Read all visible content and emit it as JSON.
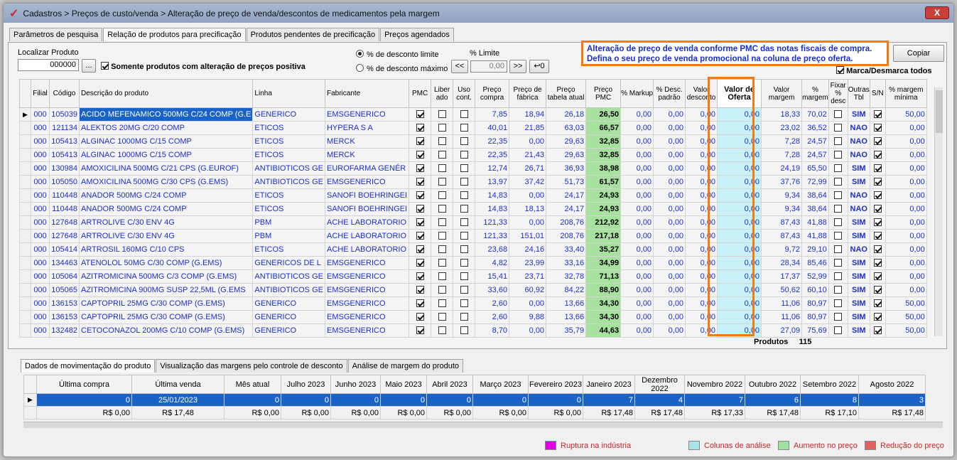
{
  "window": {
    "title": "Cadastros > Preços de custo/venda > Alteração de preço de venda/descontos de medicamentos pela margem",
    "close": "X"
  },
  "tabs": [
    "Parâmetros de pesquisa",
    "Relação de produtos para precificação",
    "Produtos pendentes de precificação",
    "Preços agendados"
  ],
  "filters": {
    "localizar_label": "Localizar Produto",
    "localizar_value": "000000",
    "ellipsis": "...",
    "somente_label": "Somente produtos com alteração de preços positiva",
    "radio1": "% de desconto limite",
    "radio2": "% de desconto máximo",
    "limite_label": "% Limite",
    "limite_value": "0,00",
    "prev": "<<",
    "next": ">>",
    "undo": "↩0",
    "copiar": "Copiar",
    "marca": "Marca/Desmarca todos"
  },
  "callout": {
    "line1": "Alteração de preço de venda conforme PMC das notas fiscais de compra.",
    "line2": "Defina o seu preço de venda promocional na coluna de preço oferta."
  },
  "grid": {
    "headers": [
      "Filial",
      "Código",
      "Descrição do produto",
      "Linha",
      "Fabricante",
      "PMC",
      "Liber ado",
      "Uso cont.",
      "Preço compra",
      "Preço de fábrica",
      "Preço tabela atual",
      "Preço PMC",
      "% Markup",
      "% Desc. padrão",
      "Valor desconto",
      "Valor de Oferta",
      "Valor margem",
      "% margem",
      "Fixar % desc",
      "Outras Tbl",
      "S/N",
      "% margem mínima"
    ],
    "rows": [
      [
        "000",
        "105039",
        "ACIDO MEFENAMICO 500MG C/24 COMP (G.E",
        "GENERICO",
        "EMSGENERICO",
        "7,85",
        "18,94",
        "26,18",
        "26,50",
        "0,00",
        "0,00",
        "0,00",
        "0,00",
        "18,33",
        "70,02",
        "SIM",
        "50,00"
      ],
      [
        "000",
        "121134",
        "ALEKTOS 20MG C/20 COMP",
        "ETICOS",
        "HYPERA S A",
        "40,01",
        "21,85",
        "63,03",
        "66,57",
        "0,00",
        "0,00",
        "0,00",
        "0,00",
        "23,02",
        "36,52",
        "NAO",
        "0,00"
      ],
      [
        "000",
        "105413",
        "ALGINAC 1000MG C/15 COMP",
        "ETICOS",
        "MERCK",
        "22,35",
        "0,00",
        "29,63",
        "32,85",
        "0,00",
        "0,00",
        "0,00",
        "0,00",
        "7,28",
        "24,57",
        "NAO",
        "0,00"
      ],
      [
        "000",
        "105413",
        "ALGINAC 1000MG C/15 COMP",
        "ETICOS",
        "MERCK",
        "22,35",
        "21,43",
        "29,63",
        "32,85",
        "0,00",
        "0,00",
        "0,00",
        "0,00",
        "7,28",
        "24,57",
        "NAO",
        "0,00"
      ],
      [
        "000",
        "130984",
        "AMOXICILINA 500MG C/21 CPS (G.EUROF)",
        "ANTIBIOTICOS GE",
        "EUROFARMA GENÉR",
        "12,74",
        "26,71",
        "36,93",
        "38,98",
        "0,00",
        "0,00",
        "0,00",
        "0,00",
        "24,19",
        "65,50",
        "SIM",
        "0,00"
      ],
      [
        "000",
        "105050",
        "AMOXICILINA 500MG C/30 CPS (G.EMS)",
        "ANTIBIOTICOS GE",
        "EMSGENERICO",
        "13,97",
        "37,42",
        "51,73",
        "61,57",
        "0,00",
        "0,00",
        "0,00",
        "0,00",
        "37,76",
        "72,99",
        "SIM",
        "0,00"
      ],
      [
        "000",
        "110448",
        "ANADOR 500MG C/24 COMP",
        "ETICOS",
        "SANOFI BOEHRINGEI",
        "14,83",
        "0,00",
        "24,17",
        "24,93",
        "0,00",
        "0,00",
        "0,00",
        "0,00",
        "9,34",
        "38,64",
        "NAO",
        "0,00"
      ],
      [
        "000",
        "110448",
        "ANADOR 500MG C/24 COMP",
        "ETICOS",
        "SANOFI BOEHRINGEI",
        "14,83",
        "18,13",
        "24,17",
        "24,93",
        "0,00",
        "0,00",
        "0,00",
        "0,00",
        "9,34",
        "38,64",
        "NAO",
        "0,00"
      ],
      [
        "000",
        "127648",
        "ARTROLIVE C/30 ENV 4G",
        "PBM",
        "ACHE LABORATORIO",
        "121,33",
        "0,00",
        "208,76",
        "212,92",
        "0,00",
        "0,00",
        "0,00",
        "0,00",
        "87,43",
        "41,88",
        "SIM",
        "0,00"
      ],
      [
        "000",
        "127648",
        "ARTROLIVE C/30 ENV 4G",
        "PBM",
        "ACHE LABORATORIO",
        "121,33",
        "151,01",
        "208,76",
        "217,18",
        "0,00",
        "0,00",
        "0,00",
        "0,00",
        "87,43",
        "41,88",
        "SIM",
        "0,00"
      ],
      [
        "000",
        "105414",
        "ARTROSIL 160MG C/10 CPS",
        "ETICOS",
        "ACHE LABORATORIO",
        "23,68",
        "24,16",
        "33,40",
        "35,27",
        "0,00",
        "0,00",
        "0,00",
        "0,00",
        "9,72",
        "29,10",
        "NAO",
        "0,00"
      ],
      [
        "000",
        "134463",
        "ATENOLOL 50MG C/30 COMP (G.EMS)",
        "GENERICOS DE L",
        "EMSGENERICO",
        "4,82",
        "23,99",
        "33,16",
        "34,99",
        "0,00",
        "0,00",
        "0,00",
        "0,00",
        "28,34",
        "85,46",
        "SIM",
        "0,00"
      ],
      [
        "000",
        "105064",
        "AZITROMICINA 500MG C/3 COMP (G.EMS)",
        "ANTIBIOTICOS GE",
        "EMSGENERICO",
        "15,41",
        "23,71",
        "32,78",
        "71,13",
        "0,00",
        "0,00",
        "0,00",
        "0,00",
        "17,37",
        "52,99",
        "SIM",
        "0,00"
      ],
      [
        "000",
        "105065",
        "AZITROMICINA 900MG SUSP 22,5ML (G.EMS",
        "ANTIBIOTICOS GE",
        "EMSGENERICO",
        "33,60",
        "60,92",
        "84,22",
        "88,90",
        "0,00",
        "0,00",
        "0,00",
        "0,00",
        "50,62",
        "60,10",
        "SIM",
        "0,00"
      ],
      [
        "000",
        "136153",
        "CAPTOPRIL 25MG C/30 COMP (G.EMS)",
        "GENERICO",
        "EMSGENERICO",
        "2,60",
        "0,00",
        "13,66",
        "34,30",
        "0,00",
        "0,00",
        "0,00",
        "0,00",
        "11,06",
        "80,97",
        "SIM",
        "50,00"
      ],
      [
        "000",
        "136153",
        "CAPTOPRIL 25MG C/30 COMP (G.EMS)",
        "GENERICO",
        "EMSGENERICO",
        "2,60",
        "9,88",
        "13,66",
        "34,30",
        "0,00",
        "0,00",
        "0,00",
        "0,00",
        "11,06",
        "80,97",
        "SIM",
        "50,00"
      ],
      [
        "000",
        "132482",
        "CETOCONAZOL 200MG C/10 COMP (G.EMS)",
        "GENERICO",
        "EMSGENERICO",
        "8,70",
        "0,00",
        "35,79",
        "44,63",
        "0,00",
        "0,00",
        "0,00",
        "0,00",
        "27,09",
        "75,69",
        "SIM",
        "50,00"
      ]
    ],
    "produtos_label": "Produtos",
    "produtos_count": "115"
  },
  "bottom_tabs": [
    "Dados de movimentação do produto",
    "Visualização das margens pelo controle de desconto",
    "Análise de margem do produto"
  ],
  "movement": {
    "headers": [
      "Última compra",
      "Última venda",
      "Mês atual",
      "Julho 2023",
      "Junho 2023",
      "Maio 2023",
      "Abril 2023",
      "Março 2023",
      "Fevereiro 2023",
      "Janeiro 2023",
      "Dezembro 2022",
      "Novembro 2022",
      "Outubro 2022",
      "Setembro 2022",
      "Agosto 2022"
    ],
    "row1": [
      "0",
      "25/01/2023",
      "0",
      "0",
      "0",
      "0",
      "0",
      "0",
      "0",
      "7",
      "4",
      "7",
      "6",
      "8",
      "3"
    ],
    "row2": [
      "R$ 0,00",
      "R$ 17,48",
      "R$ 0,00",
      "R$ 0,00",
      "R$ 0,00",
      "R$ 0,00",
      "R$ 0,00",
      "R$ 0,00",
      "R$ 0,00",
      "R$ 17,48",
      "R$ 17,48",
      "R$ 17,33",
      "R$ 17,48",
      "R$ 17,10",
      "R$ 17,48"
    ]
  },
  "legend": [
    {
      "label": "Ruptura na indústria",
      "color": "#e000e0"
    },
    {
      "label": "Colunas de análise",
      "color": "#a8e4ec"
    },
    {
      "label": "Aumento no preço",
      "color": "#a0e0a0"
    },
    {
      "label": "Redução do preço",
      "color": "#e06060"
    }
  ]
}
